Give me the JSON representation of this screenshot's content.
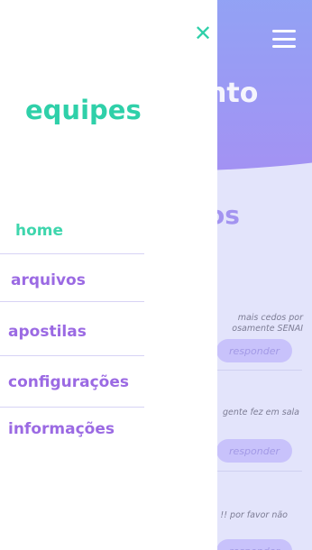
{
  "underlay": {
    "hero_title": "nto",
    "section_title": "os",
    "messages": [
      {
        "line1": "mais cedos por",
        "line2": "osamente SENAI"
      },
      {
        "line1": "gente fez em sala",
        "line2": ""
      },
      {
        "line1": "!! por favor não",
        "line2": ""
      }
    ],
    "reply_label": "responder",
    "menu_icon": "hamburger-menu-icon"
  },
  "drawer": {
    "close_icon": "✕",
    "brand": "equipes",
    "nav": [
      {
        "label": "home",
        "active": true
      },
      {
        "label": "arquivos",
        "active": false
      },
      {
        "label": "apostilas",
        "active": false
      },
      {
        "label": "configurações",
        "active": false
      },
      {
        "label": "informações",
        "active": false
      }
    ]
  },
  "colors": {
    "accent_teal": "#2fd0a9",
    "accent_purple": "#9b6ae3",
    "hero_gradient_start": "#8fa5f5",
    "hero_gradient_end": "#a392f3",
    "overlay_bg": "#e3e4fb"
  }
}
